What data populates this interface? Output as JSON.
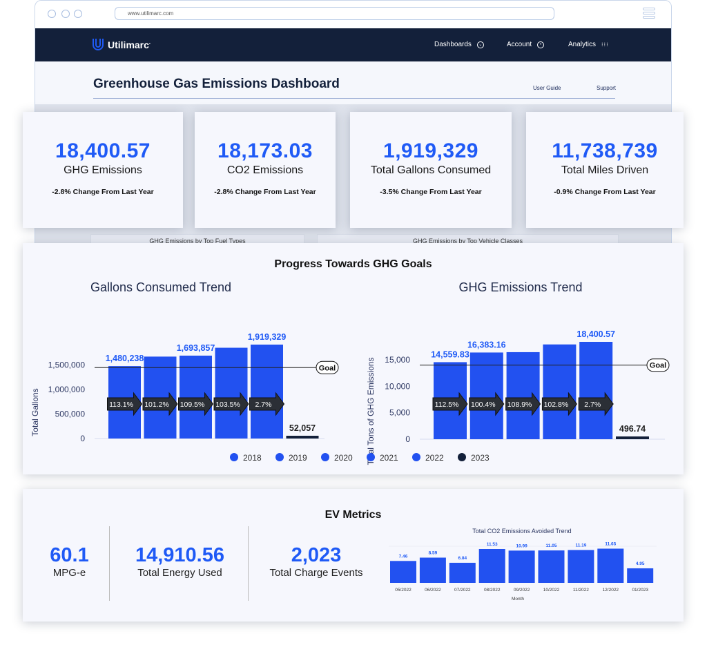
{
  "browser": {
    "url": "www.utilimarc.com"
  },
  "nav": {
    "brand": "Utilimarc",
    "items": [
      {
        "label": "Dashboards",
        "icon": "chevron-circle-down-icon"
      },
      {
        "label": "Account",
        "icon": "user-circle-icon"
      },
      {
        "label": "Analytics",
        "icon": "grid-dots-icon"
      }
    ]
  },
  "header": {
    "title": "Greenhouse Gas Emissions Dashboard",
    "links": [
      "User Guide",
      "Support"
    ]
  },
  "background_panels": [
    "GHG Emissions by Top Fuel Types",
    "GHG Emissions by Top Vehicle Classes"
  ],
  "kpis": [
    {
      "value": "18,400.57",
      "label": "GHG Emissions",
      "change": "-2.8% Change From Last Year"
    },
    {
      "value": "18,173.03",
      "label": "CO2 Emissions",
      "change": "-2.8% Change From Last Year"
    },
    {
      "value": "1,919,329",
      "label": "Total Gallons Consumed",
      "change": "-3.5% Change From Last Year"
    },
    {
      "value": "11,738,739",
      "label": "Total Miles Driven",
      "change": "-0.9% Change From Last Year"
    }
  ],
  "colors": {
    "accent": "#1f5af6",
    "bar": "#2251f0",
    "current_year": "#13203a",
    "nav": "#13203a"
  },
  "progress": {
    "title": "Progress Towards GHG Goals"
  },
  "chart_data": [
    {
      "type": "bar",
      "title": "Gallons Consumed Trend",
      "ylabel": "Total Gallons",
      "ylim": [
        0,
        2000000
      ],
      "yticks": [
        0,
        500000,
        1000000,
        1500000
      ],
      "ytick_labels": [
        "0",
        "500,000",
        "1,000,000",
        "1,500,000"
      ],
      "categories": [
        "2018",
        "2019",
        "2020",
        "2021",
        "2022",
        "2023"
      ],
      "values": [
        1480238,
        1674000,
        1693857,
        1855000,
        1919329,
        52057
      ],
      "data_labels": [
        "1,480,238",
        "",
        "1,693,857",
        "",
        "1,919,329",
        "52,057"
      ],
      "changes": [
        "113.1%",
        "101.2%",
        "109.5%",
        "103.5%",
        "2.7%"
      ],
      "goal": 1450000,
      "goal_label": "Goal"
    },
    {
      "type": "bar",
      "title": "GHG Emissions Trend",
      "ylabel": "Total Tons of GHG Emissions",
      "ylim": [
        0,
        20000
      ],
      "yticks": [
        0,
        5000,
        10000,
        15000
      ],
      "ytick_labels": [
        "0",
        "5,000",
        "10,000",
        "15,000"
      ],
      "categories": [
        "2018",
        "2019",
        "2020",
        "2021",
        "2022",
        "2023"
      ],
      "values": [
        14559.83,
        16383.16,
        16450,
        17910,
        18400.57,
        496.74
      ],
      "data_labels": [
        "14,559.83",
        "16,383.16",
        "",
        "",
        "18,400.57",
        "496.74"
      ],
      "changes": [
        "112.5%",
        "100.4%",
        "108.9%",
        "102.8%",
        "2.7%"
      ],
      "goal": 14000,
      "goal_label": "Goal"
    },
    {
      "type": "bar",
      "title": "Total CO2 Emissions Avoided Trend",
      "xlabel": "Month",
      "categories": [
        "05/2022",
        "06/2022",
        "07/2022",
        "08/2022",
        "09/2022",
        "10/2022",
        "11/2022",
        "12/2022",
        "01/2023"
      ],
      "values": [
        7.46,
        8.59,
        6.84,
        11.53,
        10.99,
        11.05,
        11.19,
        11.65,
        4.95
      ],
      "data_labels": [
        "7.46",
        "8.59",
        "6.84",
        "11.53",
        "10.99",
        "11.05",
        "11.19",
        "11.65",
        "4.95"
      ]
    }
  ],
  "legend": [
    "2018",
    "2019",
    "2020",
    "2021",
    "2022",
    "2023"
  ],
  "ev": {
    "title": "EV Metrics",
    "metrics": [
      {
        "value": "60.1",
        "label": "MPG-e"
      },
      {
        "value": "14,910.56",
        "label": "Total Energy Used"
      },
      {
        "value": "2,023",
        "label": "Total Charge Events"
      }
    ]
  }
}
